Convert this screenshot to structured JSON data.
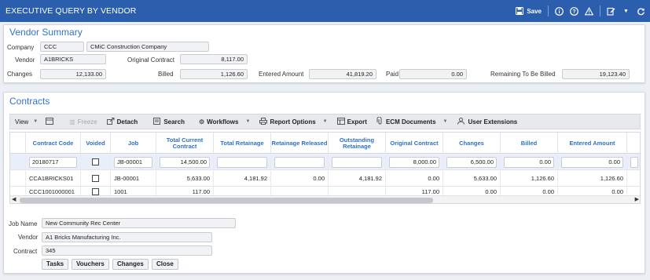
{
  "header": {
    "title": "EXECUTIVE QUERY BY VENDOR",
    "save_label": "Save"
  },
  "vendor_summary": {
    "title": "Vendor Summary",
    "company_label": "Company",
    "company_code": "CCC",
    "company_name": "CMiC Construction Company",
    "vendor_label": "Vendor",
    "vendor_code": "A1BRICKS",
    "original_contract_label": "Original Contract",
    "original_contract": "8,117.00",
    "changes_label": "Changes",
    "changes": "12,133.00",
    "billed_label": "Billed",
    "billed": "1,126.60",
    "entered_amount_label": "Entered Amount",
    "entered_amount": "41,819.20",
    "paid_label": "Paid",
    "paid": "0.00",
    "remaining_label": "Remaining To Be Billed",
    "remaining": "19,123.40"
  },
  "contracts": {
    "title": "Contracts",
    "toolbar": {
      "view": "View",
      "freeze": "Freeze",
      "detach": "Detach",
      "search": "Search",
      "workflows": "Workflows",
      "report_options": "Report Options",
      "export": "Export",
      "ecm_documents": "ECM Documents",
      "user_extensions": "User Extensions"
    },
    "columns": [
      "Contract Code",
      "Voided",
      "Job",
      "Total Current Contract",
      "Total Retainage",
      "Retainage Released",
      "Outstanding Retainage",
      "Original Contract",
      "Changes",
      "Billed",
      "Entered Amount"
    ],
    "rows": [
      {
        "code": "20180717",
        "job": "JB-00001",
        "total_current": "14,500.00",
        "total_retainage": "",
        "ret_released": "",
        "outstanding": "",
        "original": "8,000.00",
        "changes": "6,500.00",
        "billed": "0.00",
        "entered": "0.00"
      },
      {
        "code": "CCA1BRICKS01",
        "job": "JB-00001",
        "total_current": "5,633.00",
        "total_retainage": "4,181.92",
        "ret_released": "0.00",
        "outstanding": "4,181.92",
        "original": "0.00",
        "changes": "5,633.00",
        "billed": "1,126.60",
        "entered": "1,126.60"
      },
      {
        "code": "CCC1001000001",
        "job": "1001",
        "total_current": "117.00",
        "total_retainage": "",
        "ret_released": "",
        "outstanding": "",
        "original": "117.00",
        "changes": "0.00",
        "billed": "0.00",
        "entered": "0.00"
      }
    ]
  },
  "details": {
    "job_name_label": "Job Name",
    "job_name": "New Community Rec Center",
    "vendor_label": "Vendor",
    "vendor": "A1 Bricks Manufacturing Inc.",
    "contract_label": "Contract",
    "contract": "345"
  },
  "buttons": {
    "tasks": "Tasks",
    "vouchers": "Vouchers",
    "changes": "Changes",
    "close": "Close"
  }
}
